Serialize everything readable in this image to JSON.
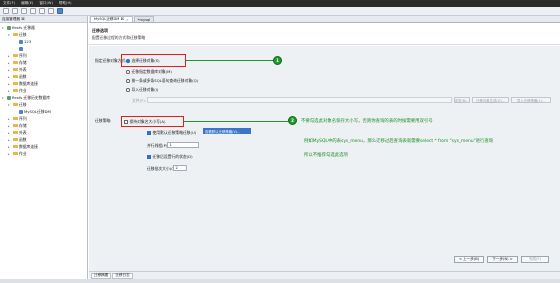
{
  "menubar": {
    "items": [
      "文件(F)",
      "编辑(E)",
      "窗口(W)",
      "帮助(H)"
    ]
  },
  "sidebar": {
    "header": "连接管理器 ⌘",
    "tree": [
      {
        "label": "flexfs 迁移器",
        "indent": 0,
        "icon": "db",
        "arrow": "▾"
      },
      {
        "label": "迁移",
        "indent": 1,
        "icon": "folder",
        "arrow": "▾"
      },
      {
        "label": "123",
        "indent": 2,
        "icon": "dbblue",
        "arrow": ""
      },
      {
        "label": "",
        "indent": 2,
        "icon": "dbblue",
        "arrow": ""
      },
      {
        "label": "序列",
        "indent": 1,
        "icon": "folder",
        "arrow": "▸"
      },
      {
        "label": "存储",
        "indent": 1,
        "icon": "folder",
        "arrow": "▸"
      },
      {
        "label": "外表",
        "indent": 1,
        "icon": "folder",
        "arrow": "▸"
      },
      {
        "label": "函数",
        "indent": 1,
        "icon": "folder",
        "arrow": "▸"
      },
      {
        "label": "数据库连接",
        "indent": 1,
        "icon": "folder",
        "arrow": "▸"
      },
      {
        "label": "作业",
        "indent": 1,
        "icon": "folder",
        "arrow": "▸"
      },
      {
        "label": "flexfs 迁移历史数据库",
        "indent": 0,
        "icon": "db",
        "arrow": "▾"
      },
      {
        "label": "迁移",
        "indent": 1,
        "icon": "folder",
        "arrow": "▾"
      },
      {
        "label": "MySQL迁移DM",
        "indent": 2,
        "icon": "dbblue",
        "arrow": ""
      },
      {
        "label": "序列",
        "indent": 1,
        "icon": "folder",
        "arrow": "▸"
      },
      {
        "label": "存储",
        "indent": 1,
        "icon": "folder",
        "arrow": "▸"
      },
      {
        "label": "外表",
        "indent": 1,
        "icon": "folder",
        "arrow": "▸"
      },
      {
        "label": "函数",
        "indent": 1,
        "icon": "folder",
        "arrow": "▸"
      },
      {
        "label": "数据库连接",
        "indent": 1,
        "icon": "folder",
        "arrow": "▸"
      },
      {
        "label": "作业",
        "indent": 1,
        "icon": "folder",
        "arrow": "▸"
      }
    ]
  },
  "tabs": [
    {
      "label": "MySQL迁移DM ⌘",
      "active": true
    },
    {
      "label": "*mysql",
      "active": false
    }
  ],
  "content": {
    "title": "迁移选项",
    "subtitle": "配置迁移过程的方式和迁移策略",
    "mode_label": "指定迁移对象方式:",
    "mode_options": [
      {
        "label": "选择迁移对象(S)",
        "checked": true
      },
      {
        "label": "迁移指定数据库对象(M)",
        "checked": false
      },
      {
        "label": "按一条或多条SQL语句查询迁移对象(Q)",
        "checked": false
      },
      {
        "label": "导入迁移对象(I)",
        "checked": false
      }
    ],
    "file_label": "文件(F):",
    "file_buttons": [
      "浏览(B)...",
      "迁移对象生成(G)...",
      "导入迁移策略(L)..."
    ],
    "strategy_label": "迁移策略:",
    "strategy_options": [
      {
        "label": "保持对象名大小写(A)",
        "checked": false
      },
      {
        "label": "使用默认迁移策略迁移(U)",
        "checked": true
      },
      {
        "label": "迁移后设置行的状态(D)",
        "checked": true
      }
    ],
    "default_strategy_btn": "查看默认迁移策略(V)...",
    "parallel_label": "并行线程(P):",
    "parallel_value": "1",
    "batch_label": "迁移批次大小(C):",
    "batch_value": "2",
    "nav_buttons": [
      "< 上一步(B)",
      "下一步(N) >",
      "完成(F)"
    ]
  },
  "annotations": {
    "badge1": "1",
    "badge2": "2",
    "text1": "不要勾选此对象名保存大小写，否则你查询的表的时候需要用双引号",
    "text2": "例如MySQL中的表sys_menu，那么迁移过后查询表就需要select * from \"sys_menu\"进行查询",
    "text3": "所以不推荐勾选此选项"
  },
  "statusbar": {
    "tabs": [
      "迁移摘要",
      "迁移日志"
    ]
  },
  "colors": {
    "accent": "#2f6fd0",
    "annotation": "#1f8a28",
    "highlight": "#e02020"
  }
}
